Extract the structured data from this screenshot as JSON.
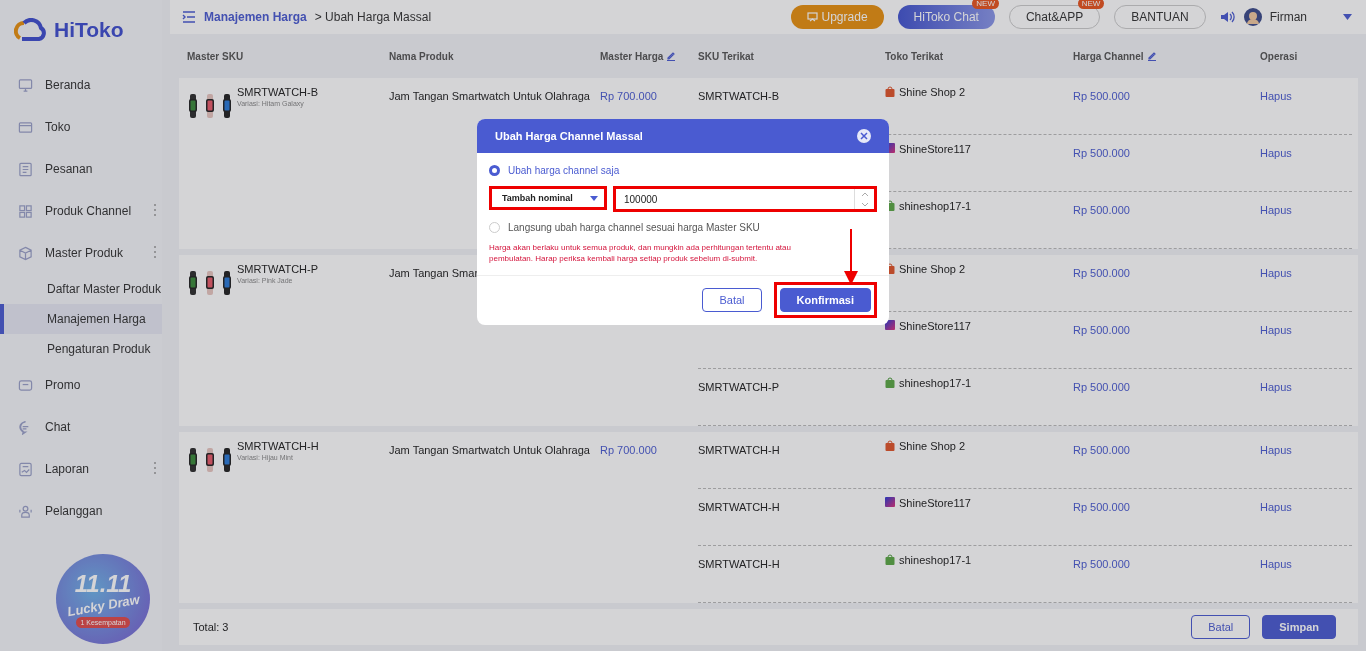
{
  "logo": {
    "text": "HiToko"
  },
  "sidebar": {
    "items": [
      {
        "label": "Beranda",
        "more": false,
        "selected": false
      },
      {
        "label": "Toko",
        "more": false,
        "selected": false
      },
      {
        "label": "Pesanan",
        "more": false,
        "selected": false
      },
      {
        "label": "Produk Channel",
        "more": true,
        "selected": false
      },
      {
        "label": "Master Produk",
        "more": true,
        "selected": false,
        "children": [
          {
            "label": "Daftar Master Produk",
            "selected": false
          },
          {
            "label": "Manajemen Harga",
            "selected": true
          },
          {
            "label": "Pengaturan Produk",
            "selected": false
          }
        ]
      },
      {
        "label": "Promo",
        "more": false,
        "selected": false
      },
      {
        "label": "Chat",
        "more": false,
        "selected": false
      },
      {
        "label": "Laporan",
        "more": true,
        "selected": false
      },
      {
        "label": "Pelanggan",
        "more": false,
        "selected": false
      }
    ],
    "promo": {
      "title": "11.11",
      "subtitle": "Lucky Draw",
      "badge": "1 Kesempatan"
    }
  },
  "topbar": {
    "breadcrumb": [
      {
        "label": "Manajemen Harga",
        "link": true
      },
      {
        "label": "> Ubah Harga Massal",
        "link": false
      }
    ],
    "buttons": [
      {
        "label": "Upgrade",
        "kind": "upgrade"
      },
      {
        "label": "HiToko Chat",
        "kind": "primary",
        "badge": "NEW"
      },
      {
        "label": "Chat&APP",
        "kind": "outline",
        "badge": "NEW"
      },
      {
        "label": "BANTUAN",
        "kind": "outline"
      }
    ],
    "user": "Firman"
  },
  "table": {
    "columns": [
      {
        "label": "Master SKU",
        "editable": false
      },
      {
        "label": "Nama Produk",
        "editable": false
      },
      {
        "label": "Master Harga",
        "editable": true
      },
      {
        "label": "SKU Terikat",
        "editable": false
      },
      {
        "label": "Toko Terikat",
        "editable": false
      },
      {
        "label": "Harga Channel",
        "editable": true
      },
      {
        "label": "Operasi",
        "editable": false
      }
    ],
    "rows": [
      {
        "sku": "SMRTWATCH-B",
        "variant": "Variasi: Hitam Galaxy",
        "name": "Jam Tangan Smartwatch Untuk Olahraga",
        "price": "Rp 700.000",
        "channels": [
          {
            "sku": "SMRTWATCH-B",
            "store": "Shine Shop 2",
            "kind": "bag",
            "price": "Rp 500.000",
            "action": "Hapus"
          },
          {
            "store": "ShineStore117",
            "kind": "square",
            "price": "Rp 500.000",
            "action": "Hapus"
          },
          {
            "store": "shineshop17-1",
            "kind": "basket",
            "price": "Rp 500.000",
            "action": "Hapus"
          }
        ]
      },
      {
        "sku": "SMRTWATCH-P",
        "variant": "Variasi: Pink Jade",
        "name": "Jam Tangan Smar",
        "channels": [
          {
            "store": "Shine Shop 2",
            "kind": "bag",
            "price": "Rp 500.000",
            "action": "Hapus"
          },
          {
            "store": "ShineStore117",
            "kind": "square",
            "price": "Rp 500.000",
            "action": "Hapus"
          },
          {
            "sku": "SMRTWATCH-P",
            "store": "shineshop17-1",
            "kind": "basket",
            "price": "Rp 500.000",
            "action": "Hapus"
          }
        ]
      },
      {
        "sku": "SMRTWATCH-H",
        "variant": "Variasi: Hijau Mint",
        "name": "Jam Tangan Smartwatch Untuk Olahraga",
        "price": "Rp 700.000",
        "channels": [
          {
            "sku": "SMRTWATCH-H",
            "store": "Shine Shop 2",
            "kind": "bag",
            "price": "Rp 500.000",
            "action": "Hapus"
          },
          {
            "sku": "SMRTWATCH-H",
            "store": "ShineStore117",
            "kind": "square",
            "price": "Rp 500.000",
            "action": "Hapus"
          },
          {
            "sku": "SMRTWATCH-H",
            "store": "shineshop17-1",
            "kind": "basket",
            "price": "Rp 500.000",
            "action": "Hapus"
          }
        ]
      }
    ]
  },
  "footer": {
    "total": "Total: 3",
    "buttons": [
      {
        "label": "Batal",
        "kind": "outline"
      },
      {
        "label": "Simpan",
        "kind": "primary"
      }
    ]
  },
  "dialog": {
    "title": "Ubah Harga Channel Massal",
    "options": [
      {
        "label": "Ubah harga channel saja",
        "selected": true
      },
      {
        "label": "Langsung ubah harga channel sesuai harga Master SKU",
        "selected": false
      }
    ],
    "mode": "Tambah nominal",
    "amount": "100000",
    "warning": "Harga akan berlaku untuk semua produk, dan mungkin ada perhitungan tertentu atau pembulatan. Harap periksa kembali harga setiap produk sebelum di-submit.",
    "buttons": [
      {
        "label": "Batal",
        "kind": "outline"
      },
      {
        "label": "Konfirmasi",
        "kind": "primary"
      }
    ]
  }
}
